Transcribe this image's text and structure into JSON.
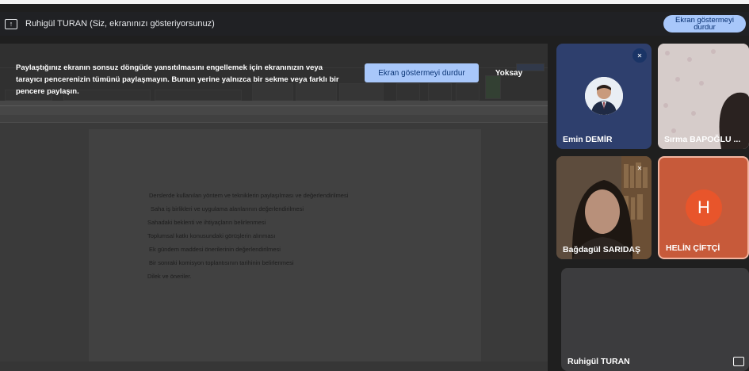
{
  "top_bar": {
    "icon": "present-to-all-icon",
    "title": "Ruhigül TURAN (Siz, ekranınızı gösteriyorsunuz)",
    "stop_button": "Ekran göstermeyi durdur"
  },
  "warning_banner": {
    "message": "Paylaştığınız ekranın sonsuz döngüde yansıtılmasını engellemek için ekranınızın veya tarayıcı pencerenizin tümünü paylaşmayın. Bunun yerine yalnızca bir sekme veya farklı bir pencere paylaşın.",
    "stop_button": "Ekran göstermeyi durdur",
    "dismiss_button": "Yoksay"
  },
  "shared_document": {
    "lines": [
      "Derslerde kullanılan yöntem ve tekniklerin paylaşılması ve değerlendirilmesi",
      "Saha iş birlikleri ve uygulama alanlarının değerlendirilmesi",
      "Sahadaki beklenti ve ihtiyaçların belirlenmesi",
      "Toplumsal katkı konusundaki görüşlerin alınması",
      "Ek gündem maddesi önerilerinin değerlendirilmesi",
      "Bir sonraki komisyon toplantısının tarihinin belirlenmesi",
      "Dilek ve öneriler."
    ]
  },
  "participants": [
    {
      "name": "Emin DEMİR",
      "muted": true,
      "type": "avatar-photo"
    },
    {
      "name": "Sırma BAPOĞLU ...",
      "muted": false,
      "type": "video"
    },
    {
      "name": "Bağdagül SARIDAŞ",
      "muted": true,
      "type": "video"
    },
    {
      "name": "HELİN ÇİFTÇİ",
      "muted": false,
      "type": "initial",
      "initial": "H",
      "active_speaker": true
    },
    {
      "name": "Ruhigül TURAN",
      "muted": false,
      "type": "self"
    }
  ],
  "colors": {
    "accent_blue": "#a8c7fa",
    "helin_tile": "#c75a3a",
    "helin_avatar": "#e8552b",
    "background": "#1f1f1f"
  }
}
